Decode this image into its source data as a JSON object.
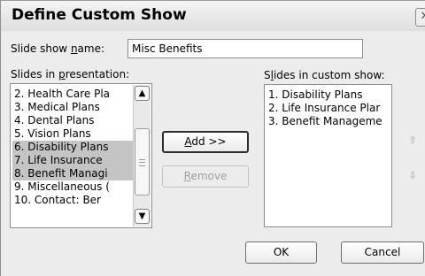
{
  "dialog": {
    "title": "Define Custom Show",
    "close_glyph": "✕"
  },
  "name_field": {
    "label_pre": "Slide show ",
    "label_key": "n",
    "label_post": "ame:",
    "value": "Misc Benefits"
  },
  "presentation": {
    "label_pre": "Slides in ",
    "label_key": "p",
    "label_post": "resentation:",
    "items": [
      {
        "text": "2. Health Care Pla",
        "selected": false
      },
      {
        "text": "3. Medical Plans",
        "selected": false
      },
      {
        "text": "4. Dental Plans",
        "selected": false
      },
      {
        "text": "5. Vision Plans",
        "selected": false
      },
      {
        "text": "6. Disability Plans",
        "selected": true
      },
      {
        "text": "7. Life Insurance",
        "selected": true
      },
      {
        "text": "8. Benefit Managi",
        "selected": true
      },
      {
        "text": "9. Miscellaneous (",
        "selected": false
      },
      {
        "text": "10. Contact:  Ber",
        "selected": false
      }
    ]
  },
  "custom_show": {
    "label_pre": "S",
    "label_key": "l",
    "label_post": "ides in custom show:",
    "items": [
      {
        "text": "1. Disability Plans"
      },
      {
        "text": "2. Life Insurance Plar"
      },
      {
        "text": "3. Benefit Manageme"
      }
    ]
  },
  "buttons": {
    "add_key": "A",
    "add_rest": "dd >>",
    "remove_key": "R",
    "remove_rest": "emove",
    "ok": "OK",
    "cancel": "Cancel"
  },
  "icons": {
    "scroll_up": "chevron-up-icon",
    "scroll_down": "chevron-down-icon",
    "move_up": "arrow-up-icon",
    "move_down": "arrow-down-icon"
  }
}
